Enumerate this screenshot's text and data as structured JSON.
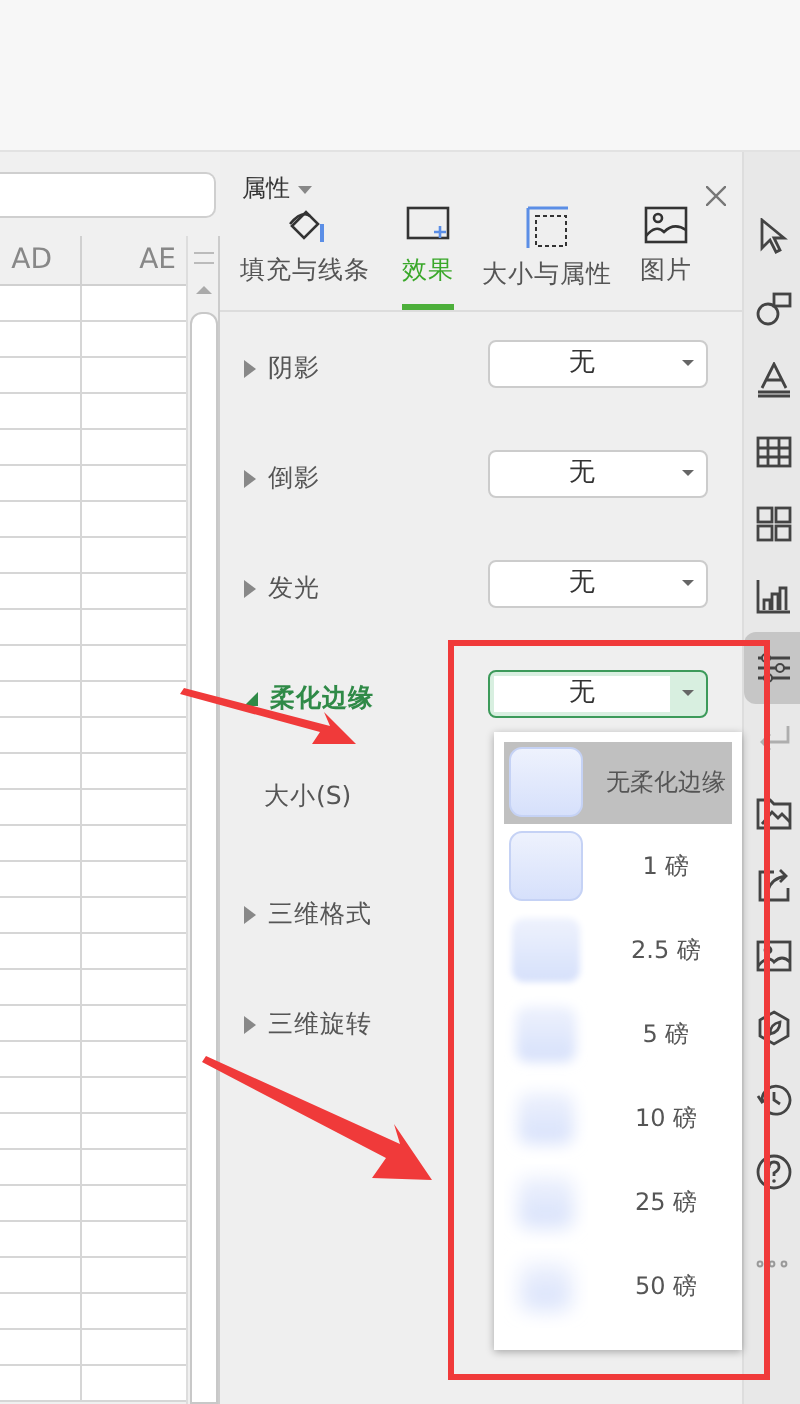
{
  "sheet": {
    "columns": [
      "AD",
      "AE"
    ]
  },
  "panel": {
    "title": "属性",
    "tabs": [
      {
        "label": "填充与线条",
        "kind": "fill",
        "selected": false
      },
      {
        "label": "效果",
        "kind": "effect",
        "selected": true
      },
      {
        "label": "大小与属性",
        "kind": "size",
        "selected": false
      },
      {
        "label": "图片",
        "kind": "picture",
        "selected": false
      }
    ],
    "sections": [
      {
        "label": "阴影",
        "expanded": false,
        "value": "无",
        "focused": false
      },
      {
        "label": "倒影",
        "expanded": false,
        "value": "无",
        "focused": false
      },
      {
        "label": "发光",
        "expanded": false,
        "value": "无",
        "focused": false
      },
      {
        "label": "柔化边缘",
        "expanded": true,
        "value": "无",
        "focused": true,
        "sub_label": "大小(S)"
      },
      {
        "label": "三维格式",
        "expanded": false
      },
      {
        "label": "三维旋转",
        "expanded": false
      }
    ],
    "dropdown": {
      "options": [
        {
          "label": "无柔化边缘",
          "selected": true
        },
        {
          "label": "1 磅",
          "selected": false
        },
        {
          "label": "2.5 磅",
          "selected": false
        },
        {
          "label": "5 磅",
          "selected": false
        },
        {
          "label": "10 磅",
          "selected": false
        },
        {
          "label": "25 磅",
          "selected": false
        },
        {
          "label": "50 磅",
          "selected": false
        }
      ]
    }
  },
  "toolbar": [
    {
      "kind": "cursor",
      "selected": false,
      "disabled": false
    },
    {
      "kind": "shapes",
      "selected": false,
      "disabled": false
    },
    {
      "kind": "text",
      "selected": false,
      "disabled": false
    },
    {
      "kind": "table",
      "selected": false,
      "disabled": false
    },
    {
      "kind": "grid",
      "selected": false,
      "disabled": false
    },
    {
      "kind": "chart",
      "selected": false,
      "disabled": false
    },
    {
      "kind": "sliders",
      "selected": true,
      "disabled": false
    },
    {
      "kind": "return",
      "selected": false,
      "disabled": true
    },
    {
      "kind": "image-folder",
      "selected": false,
      "disabled": false
    },
    {
      "kind": "share",
      "selected": false,
      "disabled": false
    },
    {
      "kind": "image",
      "selected": false,
      "disabled": false
    },
    {
      "kind": "shield",
      "selected": false,
      "disabled": false
    },
    {
      "kind": "history",
      "selected": false,
      "disabled": false
    },
    {
      "kind": "help",
      "selected": false,
      "disabled": false
    },
    {
      "kind": "more",
      "selected": false,
      "disabled": false
    }
  ],
  "annotations": [
    {
      "kind": "arrow"
    },
    {
      "kind": "arrow"
    },
    {
      "kind": "frame"
    }
  ]
}
